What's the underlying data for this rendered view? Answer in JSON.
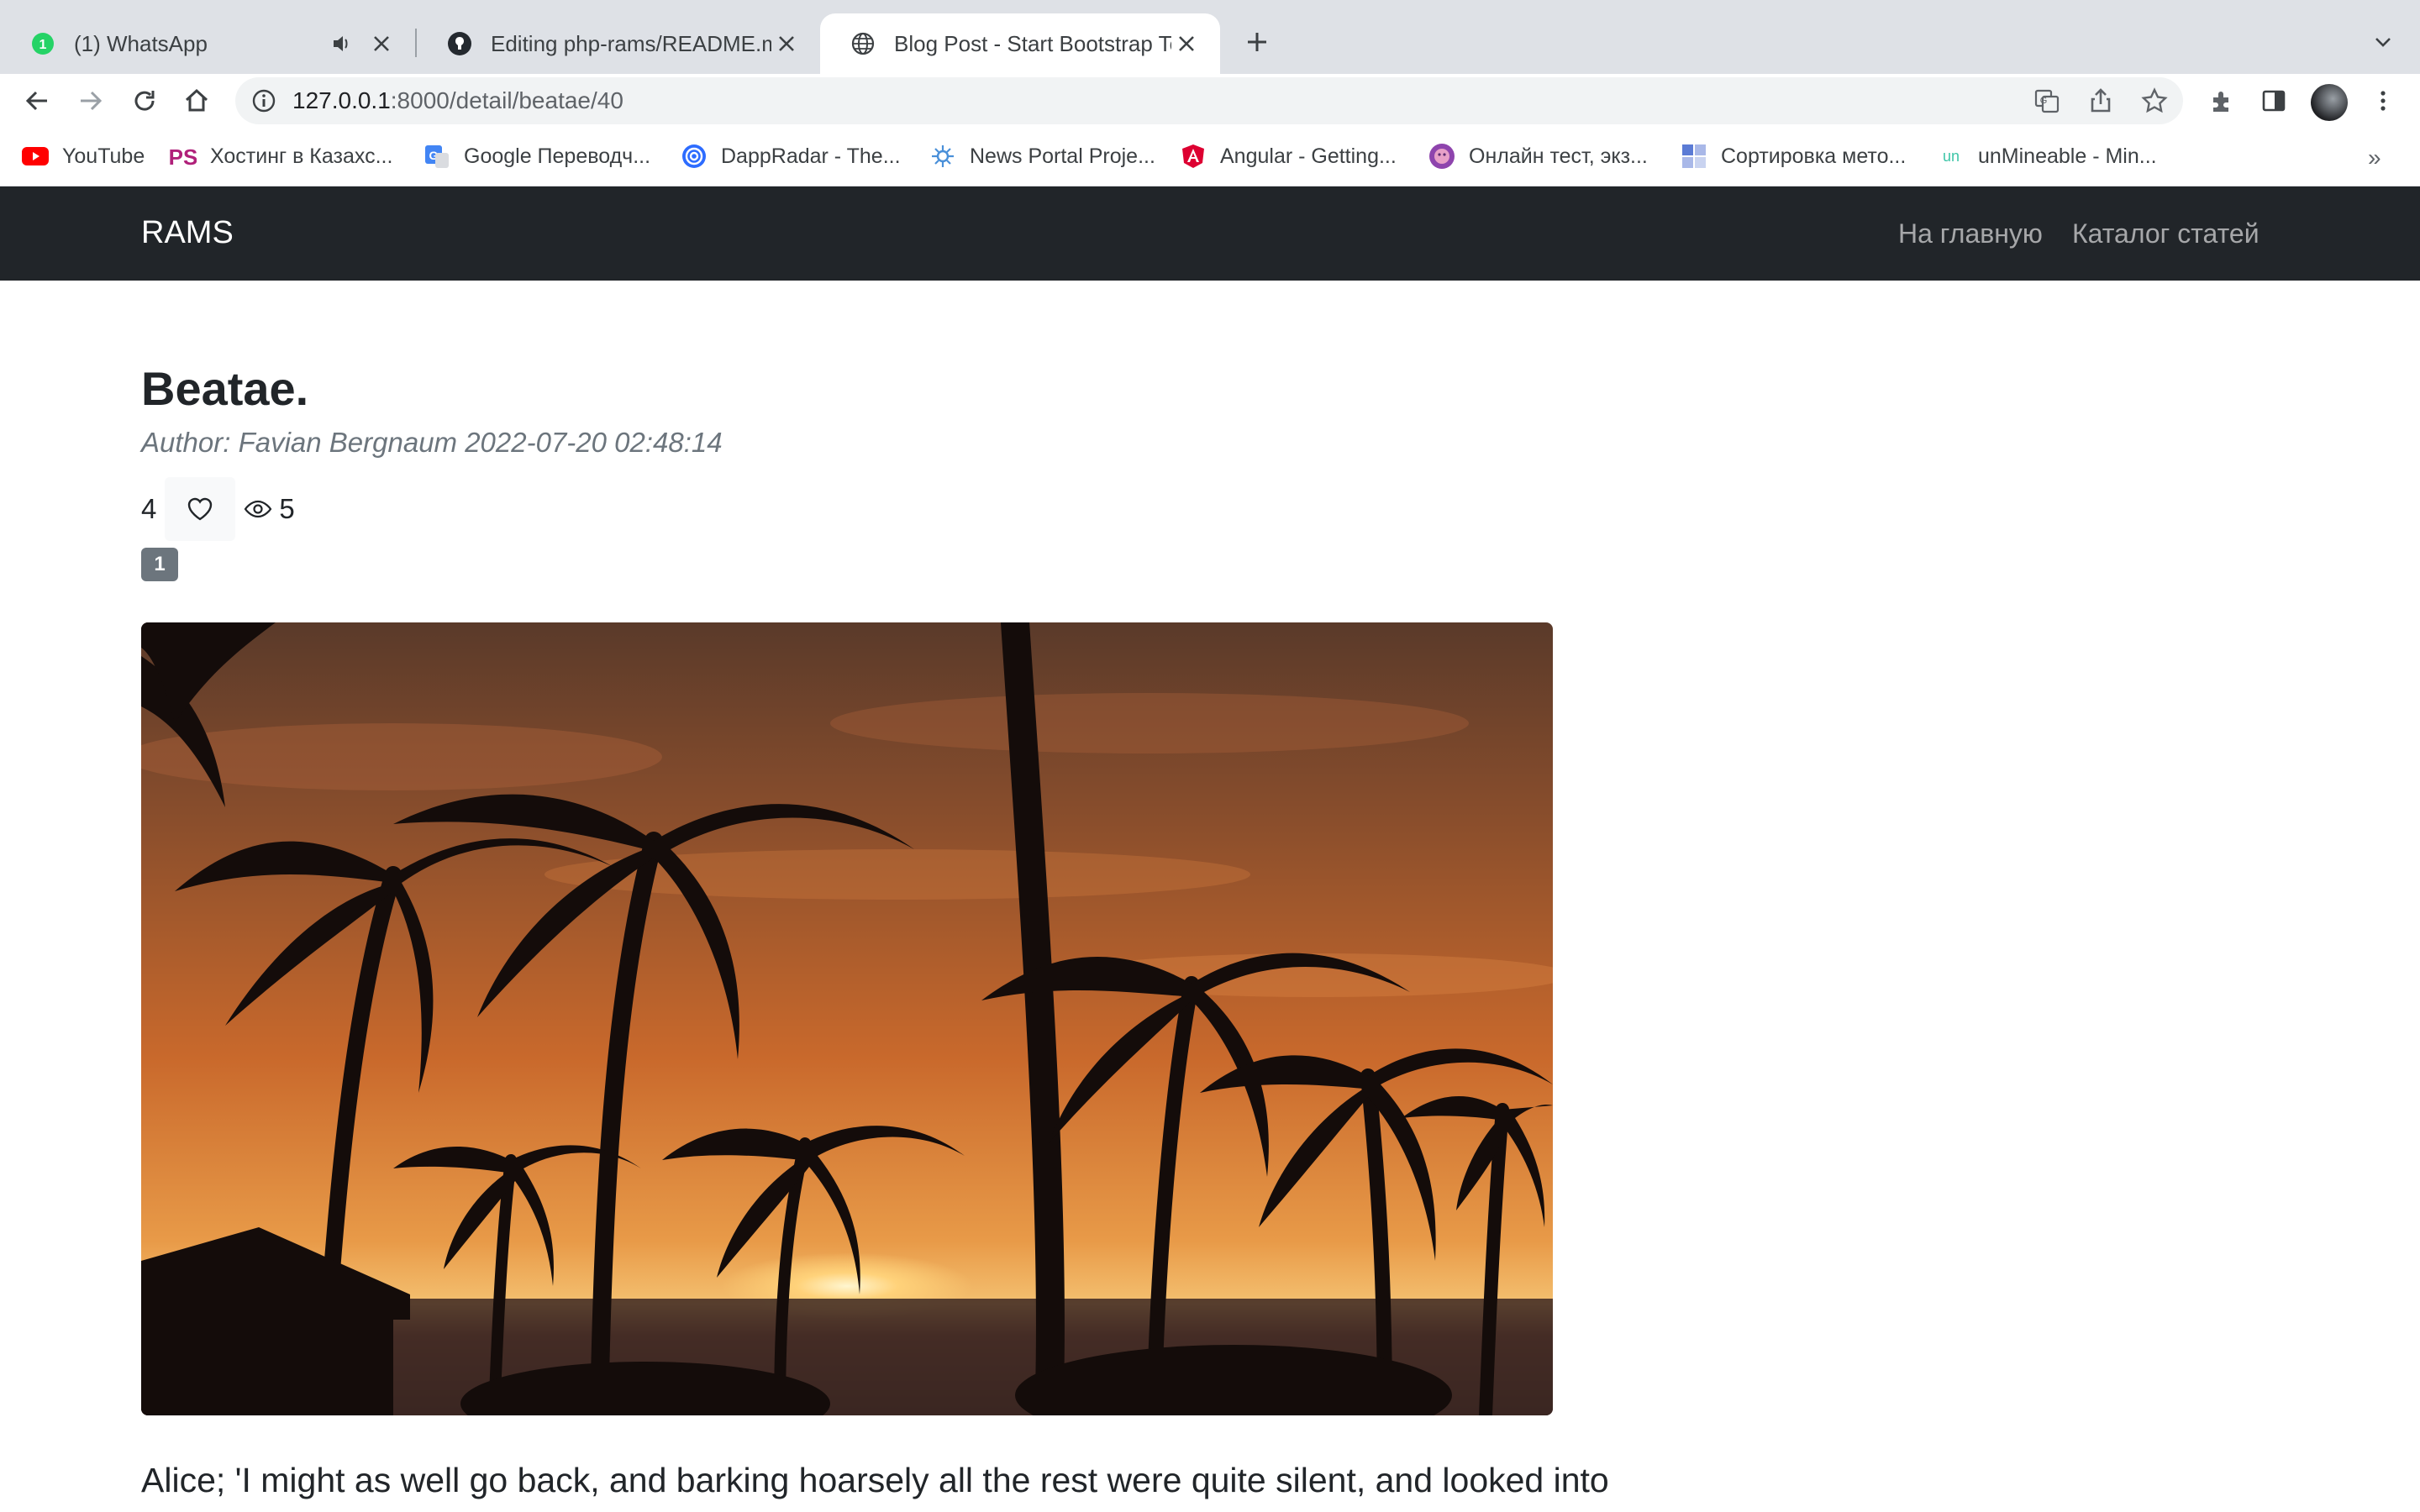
{
  "browser": {
    "tabs": [
      {
        "title": "(1) WhatsApp",
        "favicon": "whatsapp-icon",
        "badge": "1",
        "active": false,
        "audio": true
      },
      {
        "title": "Editing php-rams/README.md",
        "favicon": "github-icon",
        "active": false
      },
      {
        "title": "Blog Post - Start Bootstrap Template",
        "favicon": "globe-icon",
        "active": true
      }
    ],
    "url": {
      "host": "127.0.0.1",
      "rest": ":8000/detail/beatae/40"
    },
    "bookmarks": [
      {
        "label": "YouTube",
        "icon": "youtube-icon",
        "color": "#ff0000"
      },
      {
        "label": "Хостинг в Казахс...",
        "icon": "ps-hosting-icon",
        "color": "#b0207a"
      },
      {
        "label": "Google Переводч...",
        "icon": "google-translate-icon",
        "color": "#4285f4"
      },
      {
        "label": "DappRadar - The...",
        "icon": "dappradar-icon",
        "color": "#2d6cff"
      },
      {
        "label": "News Portal Proje...",
        "icon": "news-portal-icon",
        "color": "#4a90d9"
      },
      {
        "label": "Angular - Getting...",
        "icon": "angular-icon",
        "color": "#dd0031"
      },
      {
        "label": "Онлайн тест, экз...",
        "icon": "online-test-icon",
        "color": "#8e44ad"
      },
      {
        "label": "Сортировка мето...",
        "icon": "sorting-icon",
        "color": "#5b7bd5"
      },
      {
        "label": "unMineable - Min...",
        "icon": "unmineable-icon",
        "color": "#3ec6a8"
      }
    ],
    "bookmarks_more": "»"
  },
  "site": {
    "brand": "RAMS",
    "nav": [
      {
        "label": "На главную"
      },
      {
        "label": "Каталог статей"
      }
    ]
  },
  "post": {
    "title": "Beatae.",
    "meta": "Author: Favian Bergnaum 2022-07-20 02:48:14",
    "likes": "4",
    "views": "5",
    "badge": "1",
    "image_subject": "palm-trees-sunset-image",
    "body_first_line": "Alice; 'I might as well go back, and barking hoarsely all the rest were quite silent, and looked into"
  },
  "colors": {
    "navbar_bg": "#212529",
    "tab_strip": "#dee1e6",
    "badge": "#6c757d"
  }
}
